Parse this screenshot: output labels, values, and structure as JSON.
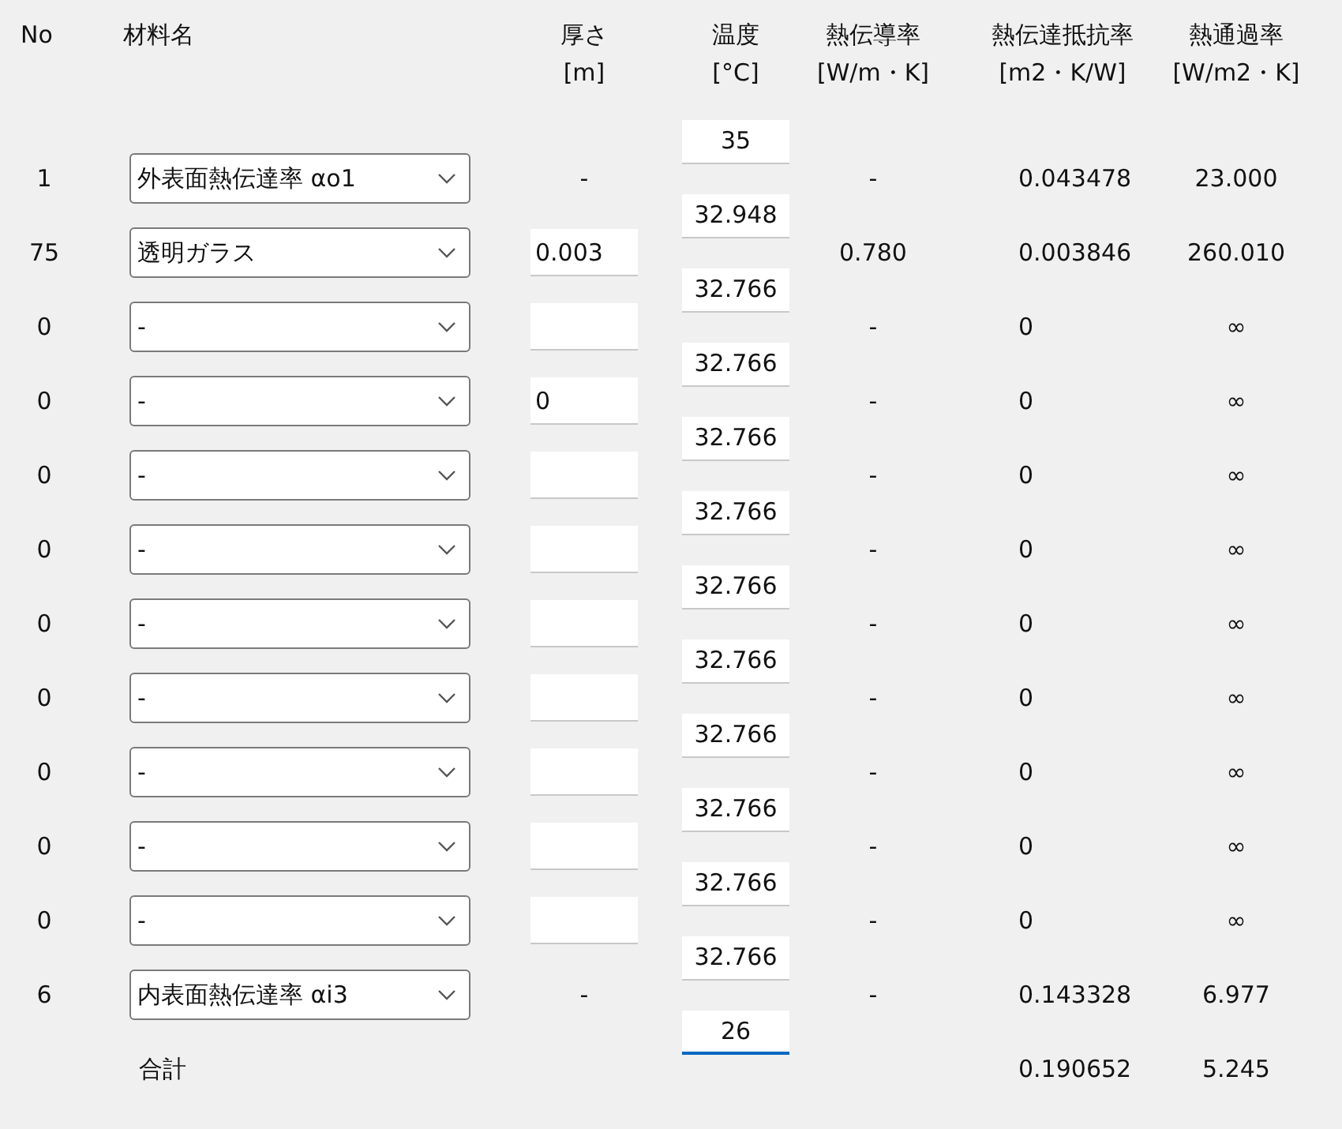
{
  "headers": {
    "no": [
      "No"
    ],
    "material": [
      "材料名"
    ],
    "thickness": [
      "厚さ",
      "[m]"
    ],
    "temperature": [
      "温度",
      "[°C]"
    ],
    "conductivity": [
      "熱伝導率",
      "[W/m・K]"
    ],
    "resistance": [
      "熱伝達抵抗率",
      "[m2・K/W]"
    ],
    "transmittance": [
      "熱通過率",
      "[W/m2・K]"
    ]
  },
  "temperatures": [
    {
      "value": "35",
      "focused": false
    },
    {
      "value": "32.948",
      "focused": false
    },
    {
      "value": "32.766",
      "focused": false
    },
    {
      "value": "32.766",
      "focused": false
    },
    {
      "value": "32.766",
      "focused": false
    },
    {
      "value": "32.766",
      "focused": false
    },
    {
      "value": "32.766",
      "focused": false
    },
    {
      "value": "32.766",
      "focused": false
    },
    {
      "value": "32.766",
      "focused": false
    },
    {
      "value": "32.766",
      "focused": false
    },
    {
      "value": "32.766",
      "focused": false
    },
    {
      "value": "32.766",
      "focused": false
    },
    {
      "value": "26",
      "focused": true
    }
  ],
  "rows": [
    {
      "kind": "text",
      "no": "1",
      "material": "外表面熱伝達率 αo1",
      "thickness": "-",
      "conductivity": "-",
      "resistance": "0.043478",
      "transmittance": "23.000"
    },
    {
      "kind": "field",
      "no": "75",
      "material": "透明ガラス",
      "thickness": "0.003",
      "conductivity": "0.780",
      "resistance": "0.003846",
      "transmittance": "260.010"
    },
    {
      "kind": "field",
      "no": "0",
      "material": "-",
      "conductivity": "-",
      "resistance": "0",
      "transmittance": "∞"
    },
    {
      "kind": "field",
      "no": "0",
      "material": "-",
      "thickness": "0",
      "conductivity": "-",
      "resistance": "0",
      "transmittance": "∞"
    },
    {
      "kind": "field",
      "no": "0",
      "material": "-",
      "conductivity": "-",
      "resistance": "0",
      "transmittance": "∞"
    },
    {
      "kind": "field",
      "no": "0",
      "material": "-",
      "conductivity": "-",
      "resistance": "0",
      "transmittance": "∞"
    },
    {
      "kind": "field",
      "no": "0",
      "material": "-",
      "conductivity": "-",
      "resistance": "0",
      "transmittance": "∞"
    },
    {
      "kind": "field",
      "no": "0",
      "material": "-",
      "conductivity": "-",
      "resistance": "0",
      "transmittance": "∞"
    },
    {
      "kind": "field",
      "no": "0",
      "material": "-",
      "conductivity": "-",
      "resistance": "0",
      "transmittance": "∞"
    },
    {
      "kind": "field",
      "no": "0",
      "material": "-",
      "conductivity": "-",
      "resistance": "0",
      "transmittance": "∞"
    },
    {
      "kind": "field",
      "no": "0",
      "material": "-",
      "conductivity": "-",
      "resistance": "0",
      "transmittance": "∞"
    },
    {
      "kind": "text",
      "no": "6",
      "material": "内表面熱伝達率 αi3",
      "thickness": "-",
      "conductivity": "-",
      "resistance": "0.143328",
      "transmittance": "6.977"
    }
  ],
  "total": {
    "label": "合計",
    "resistance": "0.190652",
    "transmittance": "5.245"
  }
}
